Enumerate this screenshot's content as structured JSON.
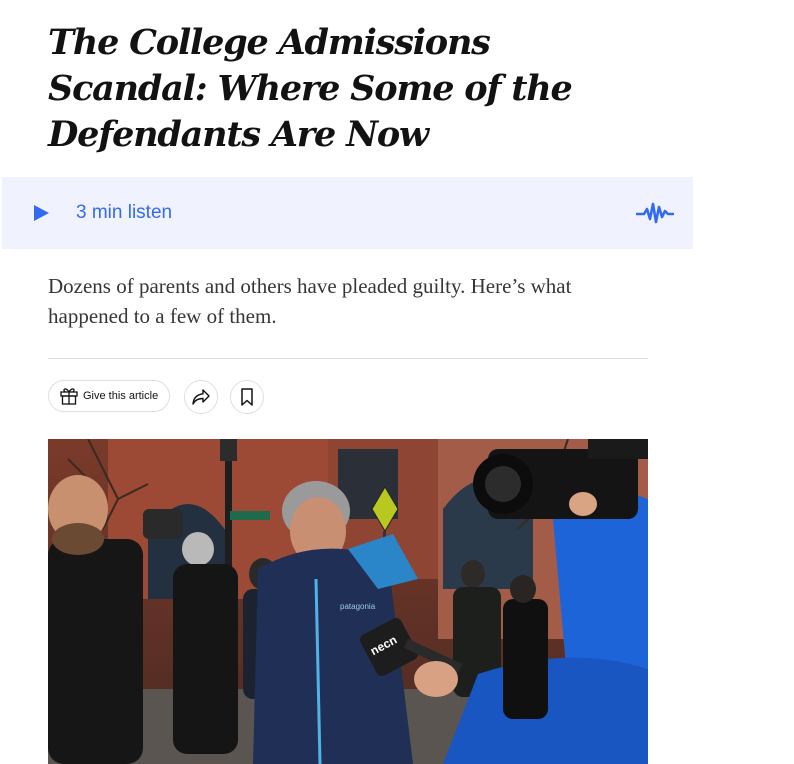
{
  "article": {
    "headline": "The College Admissions Scandal: Where Some of the Defendants Are Now",
    "summary": "Dozens of parents and others have pleaded guilty. Here’s what happened to a few of them."
  },
  "audio": {
    "label": "3 min listen",
    "play_icon": "play-icon",
    "wave_icon": "audio-wave-icon",
    "accent_color": "#326bf0",
    "background_color": "#f0f2fd"
  },
  "actions": {
    "gift_label": "Give this article",
    "gift_icon": "gift-icon",
    "share_icon": "share-icon",
    "save_icon": "bookmark-icon"
  },
  "photo": {
    "subject": "man in navy jacket walking past reporters with cameras and microphones",
    "mic_flag_text": "necn",
    "jacket_logo_text": "patagonia"
  }
}
